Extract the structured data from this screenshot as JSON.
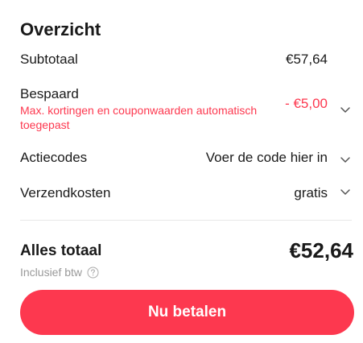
{
  "summary": {
    "title": "Overzicht",
    "subtotal": {
      "label": "Subtotaal",
      "value": "€57,64"
    },
    "saved": {
      "label": "Bespaard",
      "note": "Max. kortingen en couponwaarden automatisch toegepast",
      "value": "- €5,00"
    },
    "codes": {
      "label": "Actiecodes",
      "value": "Voer de code hier in"
    },
    "shipping": {
      "label": "Verzendkosten",
      "value": "gratis"
    },
    "total": {
      "label": "Alles totaal",
      "value": "€52,64"
    },
    "vat_note": "Inclusief btw",
    "pay_button": "Nu betalen"
  },
  "colors": {
    "accent": "#fd384f",
    "text": "#191919",
    "muted": "#999999",
    "divider": "#e8e8e8"
  },
  "icons": {
    "chevron": "chevron-down-icon",
    "help": "question-circle-icon"
  }
}
